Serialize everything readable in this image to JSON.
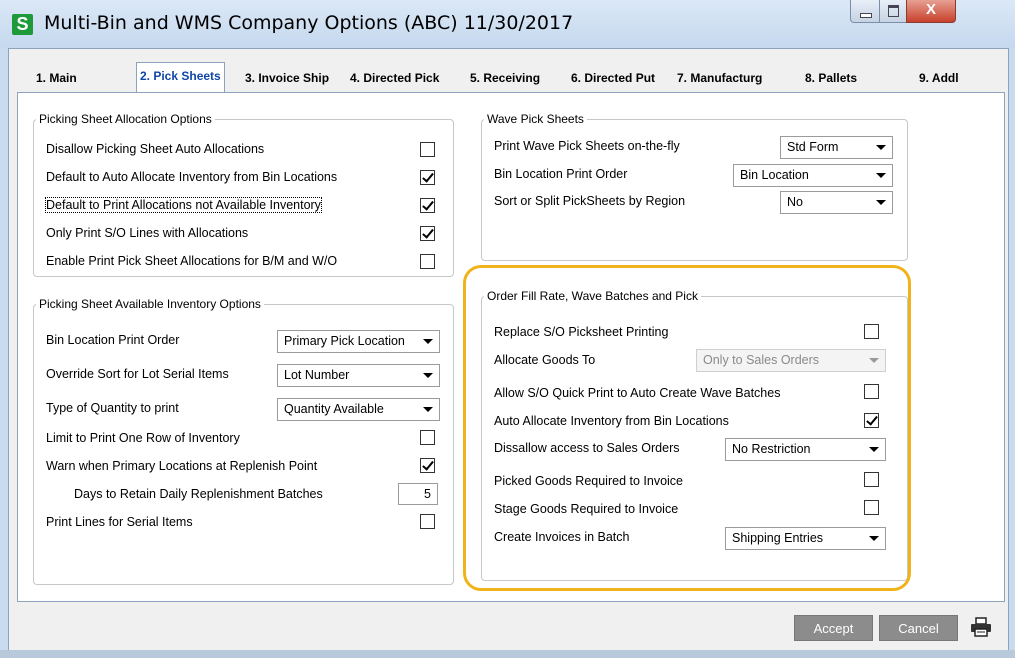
{
  "window": {
    "icon_letter": "S",
    "title": "Multi-Bin and WMS Company Options (ABC) 11/30/2017",
    "close_glyph": "X"
  },
  "tabs": [
    {
      "label": "1. Main",
      "active": false
    },
    {
      "label": "2. Pick Sheets",
      "active": true
    },
    {
      "label": "3. Invoice Ship",
      "active": false
    },
    {
      "label": "4. Directed Pick",
      "active": false
    },
    {
      "label": "5. Receiving",
      "active": false
    },
    {
      "label": "6. Directed Put",
      "active": false
    },
    {
      "label": "7. Manufacturg",
      "active": false
    },
    {
      "label": "8. Pallets",
      "active": false
    },
    {
      "label": "9. Addl",
      "active": false
    }
  ],
  "allocation_options": {
    "legend": "Picking Sheet Allocation Options",
    "items": [
      {
        "label": "Disallow Picking Sheet Auto Allocations",
        "checked": false
      },
      {
        "label": "Default to Auto Allocate Inventory from Bin Locations",
        "checked": true
      },
      {
        "label": "Default to Print Allocations not Available Inventory",
        "checked": true
      },
      {
        "label": "Only Print S/O Lines with Allocations",
        "checked": true
      },
      {
        "label": "Enable Print Pick Sheet Allocations for B/M and W/O",
        "checked": false
      }
    ]
  },
  "available_inventory": {
    "legend": "Picking Sheet Available Inventory Options",
    "bin_location_print_order": {
      "label": "Bin Location Print Order",
      "value": "Primary Pick Location"
    },
    "override_sort": {
      "label": "Override Sort for Lot Serial Items",
      "value": "Lot Number"
    },
    "quantity_type": {
      "label": "Type of Quantity to print",
      "value": "Quantity Available"
    },
    "limit_one_row": {
      "label": "Limit to Print One Row of Inventory",
      "checked": false
    },
    "warn_replenish": {
      "label": "Warn when Primary Locations at Replenish Point",
      "checked": true
    },
    "days_retain": {
      "label": "Days to Retain Daily Replenishment Batches",
      "value": "5"
    },
    "print_serial": {
      "label": "Print Lines for Serial Items",
      "checked": false
    }
  },
  "wave_pick": {
    "legend": "Wave Pick Sheets",
    "on_the_fly": {
      "label": "Print Wave Pick Sheets on-the-fly",
      "value": "Std Form"
    },
    "bin_print_order": {
      "label": "Bin Location Print Order",
      "value": "Bin Location"
    },
    "sort_split": {
      "label": "Sort or Split PickSheets by Region",
      "value": "No"
    }
  },
  "order_fill": {
    "legend": "Order Fill Rate, Wave Batches and Pick",
    "replace_printing": {
      "label": "Replace S/O Picksheet Printing",
      "checked": false
    },
    "allocate_goods": {
      "label": "Allocate Goods To",
      "value": "Only to Sales Orders"
    },
    "quick_print": {
      "label": "Allow S/O Quick Print to Auto Create Wave Batches",
      "checked": false
    },
    "auto_allocate": {
      "label": "Auto Allocate Inventory from Bin Locations",
      "checked": true
    },
    "dissallow_access": {
      "label": "Dissallow access to Sales Orders",
      "value": "No Restriction"
    },
    "picked_required": {
      "label": "Picked Goods Required to Invoice",
      "checked": false
    },
    "stage_required": {
      "label": "Stage Goods Required to Invoice",
      "checked": false
    },
    "create_invoices": {
      "label": "Create Invoices in Batch",
      "value": "Shipping Entries"
    }
  },
  "buttons": {
    "accept": "Accept",
    "cancel": "Cancel"
  },
  "colors": {
    "highlight": "#f0b31c",
    "active_tab_text": "#1046a6",
    "app_icon": "#1e9a3a"
  }
}
